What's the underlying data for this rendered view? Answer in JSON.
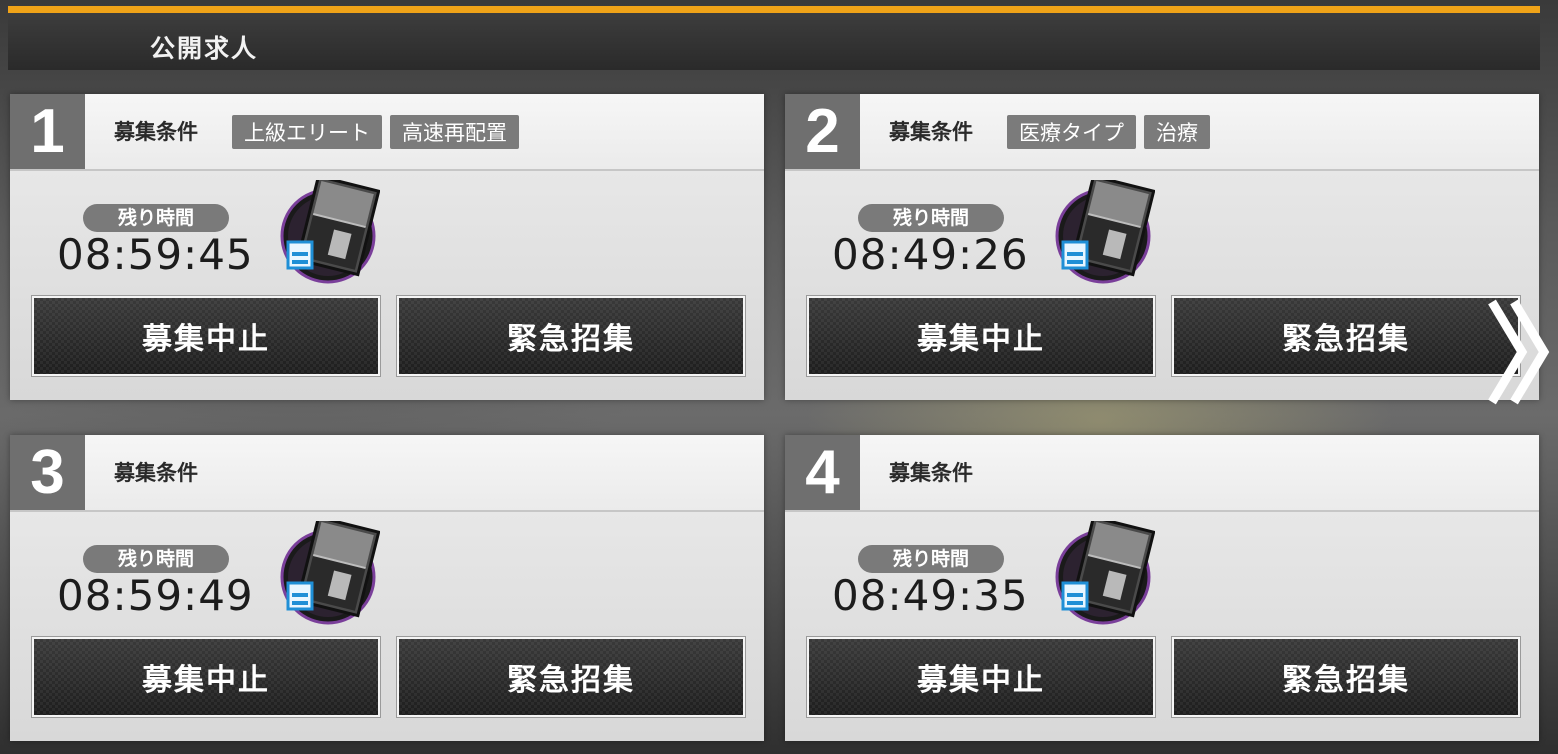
{
  "header": {
    "title": "公開求人"
  },
  "labels": {
    "condition": "募集条件",
    "remaining": "残り時間",
    "stop_button": "募集中止",
    "expedite_button": "緊急招集"
  },
  "slots": [
    {
      "number": "1",
      "tags": [
        "上級エリート",
        "高速再配置"
      ],
      "time": "08:59:45"
    },
    {
      "number": "2",
      "tags": [
        "医療タイプ",
        "治療"
      ],
      "time": "08:49:26"
    },
    {
      "number": "3",
      "tags": [],
      "time": "08:59:49"
    },
    {
      "number": "4",
      "tags": [],
      "time": "08:49:35"
    }
  ],
  "icons": {
    "document": "recruitment-permit-icon",
    "next": "double-chevron-right-icon"
  },
  "colors": {
    "accent": "#f0a318",
    "header_bg": "#2f2f2f",
    "tag_bg": "#7b7b7b",
    "number_bg": "#6f6f6f",
    "button_bg": "#2a2a2a"
  }
}
